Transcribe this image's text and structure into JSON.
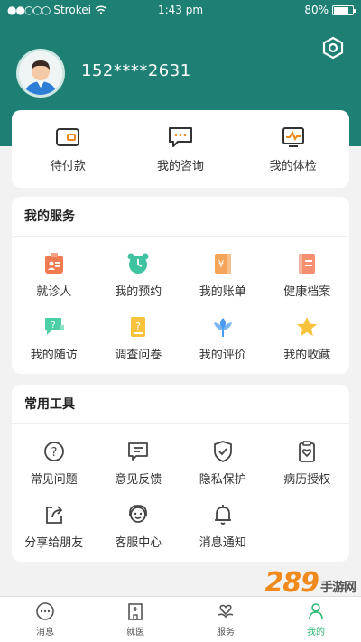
{
  "status_bar": {
    "carrier": "Strokei",
    "time": "1:43 pm",
    "battery": "80%",
    "battery_level": 0.8
  },
  "profile": {
    "phone": "152****2631"
  },
  "quick_actions": [
    {
      "label": "待付款",
      "icon": "wallet-icon"
    },
    {
      "label": "我的咨询",
      "icon": "chat-bubble-icon"
    },
    {
      "label": "我的体检",
      "icon": "monitor-pulse-icon"
    }
  ],
  "services": {
    "title": "我的服务",
    "items": [
      {
        "label": "就诊人",
        "icon": "patient-card-icon",
        "color": "#f07b51"
      },
      {
        "label": "我的预约",
        "icon": "alarm-clock-icon",
        "color": "#3fc3a0"
      },
      {
        "label": "我的账单",
        "icon": "bill-icon",
        "color": "#f4a55a"
      },
      {
        "label": "健康档案",
        "icon": "health-record-icon",
        "color": "#f49070"
      },
      {
        "label": "我的随访",
        "icon": "followup-chat-icon",
        "color": "#4ccfa6"
      },
      {
        "label": "调查问卷",
        "icon": "questionnaire-icon",
        "color": "#f7c23c"
      },
      {
        "label": "我的评价",
        "icon": "flower-icon",
        "color": "#4a9af0"
      },
      {
        "label": "我的收藏",
        "icon": "star-icon",
        "color": "#f7c23c"
      }
    ]
  },
  "tools": {
    "title": "常用工具",
    "items": [
      {
        "label": "常见问题",
        "icon": "question-icon"
      },
      {
        "label": "意见反馈",
        "icon": "feedback-icon"
      },
      {
        "label": "隐私保护",
        "icon": "shield-check-icon"
      },
      {
        "label": "病历授权",
        "icon": "clipboard-heart-icon"
      },
      {
        "label": "分享给朋友",
        "icon": "share-icon"
      },
      {
        "label": "客服中心",
        "icon": "customer-service-icon"
      },
      {
        "label": "消息通知",
        "icon": "bell-icon"
      }
    ]
  },
  "tabs": [
    {
      "label": "消息",
      "icon": "message-icon"
    },
    {
      "label": "就医",
      "icon": "hospital-icon"
    },
    {
      "label": "服务",
      "icon": "heart-hand-icon"
    },
    {
      "label": "我的",
      "icon": "person-icon",
      "active": true
    }
  ],
  "watermark": {
    "text": "289",
    "suffix": "手游网"
  },
  "colors": {
    "header": "#1e7f74",
    "active_tab": "#2bb673"
  }
}
